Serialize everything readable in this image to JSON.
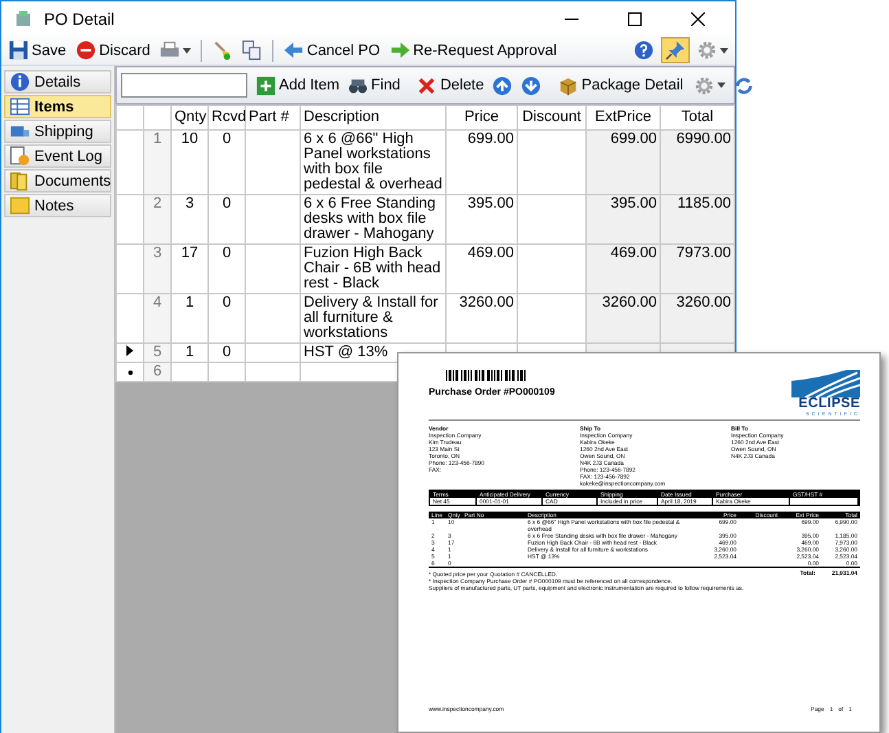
{
  "window": {
    "title": "PO Detail"
  },
  "toolbar": {
    "save": "Save",
    "discard": "Discard",
    "cancel": "Cancel PO",
    "rerequest": "Re-Request Approval",
    "pin_on": true
  },
  "sidebar": {
    "items": [
      {
        "label": "Details",
        "kind": "details",
        "selected": false
      },
      {
        "label": "Items",
        "kind": "items",
        "selected": true
      },
      {
        "label": "Shipping",
        "kind": "shipping",
        "selected": false
      },
      {
        "label": "Event Log",
        "kind": "log",
        "selected": false
      },
      {
        "label": "Documents",
        "kind": "documents",
        "selected": false
      },
      {
        "label": "Notes",
        "kind": "notes",
        "selected": false
      }
    ]
  },
  "grid_toolbar": {
    "add": "Add Item",
    "find": "Find",
    "delete": "Delete",
    "package": "Package Detail"
  },
  "grid": {
    "columns": [
      "Qnty",
      "Rcvd",
      "Part #",
      "Description",
      "Price",
      "Discount",
      "ExtPrice",
      "Total"
    ],
    "rows": [
      {
        "num": "1",
        "kind": "item",
        "current": false,
        "qnty": "10",
        "rcvd": "0",
        "description": "6 x 6 @66\" High Panel workstations with box file pedestal & overhead",
        "price": "699.00",
        "ext_price": "699.00",
        "total": "6990.00"
      },
      {
        "num": "2",
        "kind": "item",
        "current": false,
        "qnty": "3",
        "rcvd": "0",
        "description": "6 x 6 Free Standing desks with box file drawer - Mahogany",
        "price": "395.00",
        "ext_price": "395.00",
        "total": "1185.00"
      },
      {
        "num": "3",
        "kind": "item",
        "current": false,
        "qnty": "17",
        "rcvd": "0",
        "description": "Fuzion High Back Chair - 6B with head rest - Black",
        "price": "469.00",
        "ext_price": "469.00",
        "total": "7973.00"
      },
      {
        "num": "4",
        "kind": "item",
        "current": false,
        "qnty": "1",
        "rcvd": "0",
        "description": "Delivery & Install for all furniture & workstations",
        "price": "3260.00",
        "ext_price": "3260.00",
        "total": "3260.00"
      },
      {
        "num": "5",
        "kind": "item",
        "current": true,
        "qnty": "1",
        "rcvd": "0",
        "description": "HST @ 13%"
      },
      {
        "num": "6",
        "kind": "new",
        "current": false
      }
    ]
  },
  "document": {
    "title": "Purchase Order #PO000109",
    "logo": "ECLIPSE",
    "logo_sub": "SCIENTIFIC",
    "addresses": [
      {
        "heading": "Vendor",
        "lines": [
          "Inspection Company",
          "Kim Trudeau",
          "123 Main St",
          "Toronto, ON",
          "Phone: 123-456-7890",
          "FAX:"
        ]
      },
      {
        "heading": "Ship To",
        "lines": [
          "Inspection Company",
          "Kabira Okeke",
          "1260 2nd Ave East",
          "Owen Sound, ON",
          "N4K 2J3 Canada",
          "Phone: 123-456-7892",
          "FAX: 123-456-7892",
          "kokeke@inspectioncompany.com"
        ]
      },
      {
        "heading": "Bill To",
        "lines": [
          "Inspection Company",
          "1260 2nd Ave East",
          "Owen Sound, ON",
          "N4K 2J3 Canada"
        ]
      }
    ],
    "terms_columns": [
      "Terms",
      "Anticipated Delivery",
      "Currency",
      "Shipping",
      "Date Issued",
      "Purchaser",
      "GST/HST #"
    ],
    "terms_values": [
      "Net 45",
      "0001-01-01",
      "CAD",
      "Included in price",
      "April 18, 2019",
      "Kabira Okeke"
    ],
    "item_columns": [
      "Line",
      "Qnty",
      "Part No",
      "Description",
      "Price",
      "Discount",
      "Ext Price",
      "Total"
    ],
    "items": [
      {
        "line": "1",
        "qnty": "10",
        "description": "6 x 6 @66\" High Panel workstations with box file pedestal & overhead",
        "price": "699.00",
        "ext_price": "699.00",
        "total": "6,990.00"
      },
      {
        "line": "2",
        "qnty": "3",
        "description": "6 x 6 Free Standing desks with box file drawer - Mahogany",
        "price": "395.00",
        "ext_price": "395.00",
        "total": "1,185.00"
      },
      {
        "line": "3",
        "qnty": "17",
        "description": "Fuzion High Back Chair - 6B with head rest - Black",
        "price": "469.00",
        "ext_price": "469.00",
        "total": "7,973.00"
      },
      {
        "line": "4",
        "qnty": "1",
        "description": "Delivery & Install for all furniture & workstations",
        "price": "3,260.00",
        "ext_price": "3,260.00",
        "total": "3,260.00"
      },
      {
        "line": "5",
        "qnty": "1",
        "description": "HST @ 13%",
        "price": "2,523.04",
        "ext_price": "2,523.04",
        "total": "2,523.04"
      },
      {
        "line": "6",
        "qnty": "0",
        "ext_price": "0.00",
        "total": "0.00"
      }
    ],
    "total_label": "Total:",
    "total": "21,931.04",
    "notes": [
      "* Quoted price per your Quotation # CANCELLED.",
      "* Inspection Company Purchase Order # PO000109 must be referenced on all correspondence.",
      "Suppliers of manufactured parts, UT parts, equipment and electronic instrumentation are required to follow requirements as."
    ],
    "footer_url": "www.inspectioncompany.com",
    "page_label": "Page",
    "page_num": "1",
    "page_of": "of",
    "page_total": "1"
  }
}
